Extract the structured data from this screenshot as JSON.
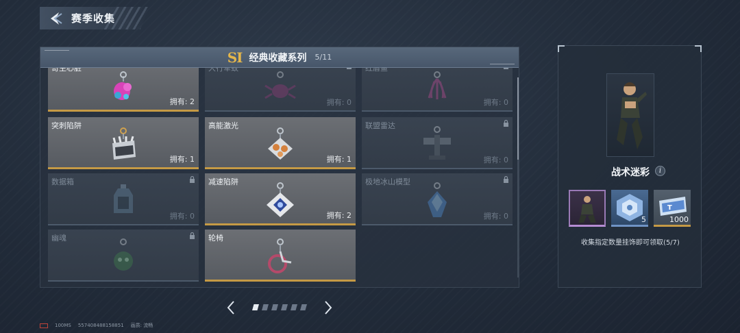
{
  "header": {
    "title": "赛季收集"
  },
  "series": {
    "season": "SI",
    "title": "经典收藏系列",
    "count": "5/11"
  },
  "cards": [
    {
      "name": "奇生心脏",
      "owned": "拥有: 2",
      "locked": false,
      "icon": "heart-charm-icon"
    },
    {
      "name": "大行军蚁",
      "owned": "拥有: 0",
      "locked": true,
      "icon": "ant-charm-icon"
    },
    {
      "name": "红唇鱼",
      "owned": "拥有: 0",
      "locked": true,
      "icon": "squid-charm-icon"
    },
    {
      "name": "突刺陷阱",
      "owned": "拥有: 1",
      "locked": false,
      "icon": "spike-trap-charm-icon"
    },
    {
      "name": "高能激光",
      "owned": "拥有: 1",
      "locked": false,
      "icon": "laser-charm-icon"
    },
    {
      "name": "联盟雷达",
      "owned": "拥有: 0",
      "locked": true,
      "icon": "radar-charm-icon"
    },
    {
      "name": "数据箱",
      "owned": "拥有: 0",
      "locked": true,
      "icon": "data-box-charm-icon"
    },
    {
      "name": "减速陷阱",
      "owned": "拥有: 2",
      "locked": false,
      "icon": "slow-trap-charm-icon"
    },
    {
      "name": "极地冰山模型",
      "owned": "拥有: 0",
      "locked": true,
      "icon": "iceberg-charm-icon"
    },
    {
      "name": "幽魂",
      "owned": "",
      "locked": true,
      "icon": "ghost-charm-icon"
    },
    {
      "name": "轮椅",
      "owned": "",
      "locked": false,
      "icon": "wheelchair-charm-icon"
    }
  ],
  "pagination": {
    "pages": 6,
    "current": 1
  },
  "reward": {
    "name": "战术迷彩",
    "items": [
      {
        "type": "skin",
        "qty": ""
      },
      {
        "type": "crate",
        "qty": "5"
      },
      {
        "type": "tickets",
        "qty": "1000"
      }
    ],
    "hint": "收集指定数量挂饰即可领取(5/7)"
  },
  "footer": {
    "ping": "100MS",
    "id": "557408488158851",
    "quality_label": "画质: 流畅"
  },
  "colors": {
    "accent_gold": "#c59a45",
    "season_gold": "#e4b64b",
    "skin_purple": "#b58cd2",
    "crate_blue": "#6f93c4"
  }
}
